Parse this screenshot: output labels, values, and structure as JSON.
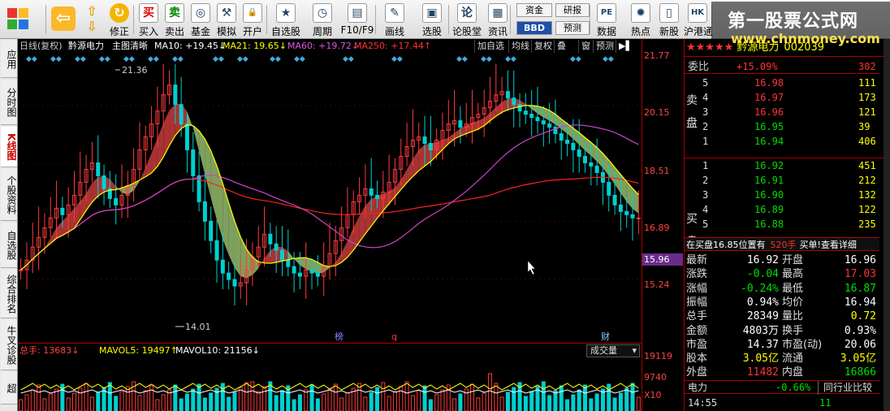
{
  "toolbar": {
    "items": [
      {
        "label": "",
        "icon": "logo-grid-icon"
      },
      {
        "label": "",
        "icon": "back-arrow-icon"
      },
      {
        "label": "",
        "icon": "up-down-arrows-icon"
      },
      {
        "label": "修正",
        "icon": "refresh-icon"
      },
      {
        "label": "买入",
        "icon": "buy-icon",
        "glyph": "买"
      },
      {
        "label": "卖出",
        "icon": "sell-icon",
        "glyph": "卖"
      },
      {
        "label": "基金",
        "icon": "fund-icon",
        "glyph": "◎"
      },
      {
        "label": "模拟",
        "icon": "hammer-icon",
        "glyph": "⚒"
      },
      {
        "label": "开户",
        "icon": "lock-icon",
        "glyph": "🔒"
      },
      {
        "label": "自选股",
        "icon": "star-folder-icon",
        "glyph": "★"
      },
      {
        "label": "周期",
        "icon": "clock-icon",
        "glyph": "◷"
      },
      {
        "label": "F10/F9",
        "icon": "f10-icon",
        "glyph": "▤"
      },
      {
        "label": "画线",
        "icon": "pencil-icon",
        "glyph": "✎"
      },
      {
        "label": "选股",
        "icon": "screen-icon",
        "glyph": "▣"
      },
      {
        "label": "论股堂",
        "icon": "forum-icon",
        "glyph": "论"
      },
      {
        "label": "资讯",
        "icon": "news-icon",
        "glyph": "▦"
      },
      {
        "label": "数据",
        "icon": "pe-icon",
        "glyph": "PE"
      },
      {
        "label": "热点",
        "icon": "flame-icon",
        "glyph": "✹"
      },
      {
        "label": "新股",
        "icon": "ipo-icon",
        "glyph": "▯"
      },
      {
        "label": "沪港通",
        "icon": "hk-icon",
        "glyph": "HK"
      }
    ],
    "small_buttons": [
      "资金",
      "BBD",
      "研报",
      "预测"
    ]
  },
  "watermark": {
    "line1": "第一股票公式网",
    "line2": "www.chnmoney.com"
  },
  "left_tabs": [
    "应用",
    "分时图",
    "K线图",
    "个股资料",
    "自选股",
    "综合排名",
    "牛叉诊股",
    "超"
  ],
  "chart": {
    "period": "日线(复权)",
    "name": "黔源电力",
    "mode": "主图清晰",
    "ma10": "MA10: +19.45↓",
    "ma21": "MA21: 19.65↓",
    "ma60": "MA60: +19.72↓",
    "ma250": "MA250: +17.44↑",
    "tags": [
      "加自选",
      "均线",
      "复权",
      "叠",
      "窗",
      "预测"
    ],
    "high_label": "21.36",
    "low_label": "14.01",
    "markers": [
      "榜",
      "q",
      "财"
    ],
    "price_levels": [
      "21.77",
      "20.15",
      "18.51",
      "16.89",
      "15.96",
      "15.24"
    ],
    "current_price_tag": "15.96",
    "vol_levels": [
      "19119",
      "9740",
      "X10"
    ]
  },
  "chart_data": {
    "type": "candlestick",
    "title": "黔源电力 日线(复权)",
    "ylim": [
      13.6,
      21.77
    ],
    "closes": [
      15.3,
      15.6,
      16.0,
      16.3,
      16.6,
      16.9,
      17.2,
      17.0,
      17.3,
      17.6,
      18.0,
      18.4,
      18.6,
      18.2,
      17.8,
      17.5,
      17.3,
      17.6,
      17.9,
      18.4,
      19.0,
      19.4,
      19.8,
      20.2,
      20.7,
      21.0,
      20.4,
      19.8,
      19.0,
      18.2,
      17.4,
      16.8,
      16.2,
      15.6,
      15.2,
      15.0,
      14.8,
      14.9,
      15.3,
      15.7,
      16.0,
      16.4,
      16.1,
      15.9,
      15.6,
      15.4,
      15.2,
      15.1,
      15.3,
      15.2,
      15.1,
      15.4,
      15.8,
      16.2,
      16.6,
      17.0,
      17.4,
      17.6,
      17.8,
      17.6,
      17.5,
      17.7,
      18.0,
      18.4,
      18.8,
      19.1,
      19.3,
      19.4,
      19.2,
      19.0,
      19.3,
      19.6,
      19.8,
      19.9,
      19.7,
      19.8,
      20.0,
      20.1,
      20.3,
      20.5,
      20.7,
      20.8,
      20.6,
      20.4,
      20.2,
      20.1,
      20.0,
      19.9,
      19.8,
      19.7,
      19.5,
      19.3,
      19.2,
      19.0,
      18.8,
      18.6,
      18.5,
      18.3,
      18.0,
      17.6,
      17.3,
      17.1,
      17.0,
      16.9,
      16.9
    ]
  },
  "volume": {
    "label": "总手: 13683↓",
    "mavol5": "MAVOL5: 19497↑",
    "mavol10": "MAVOL10: 21156↓",
    "selector": "成交量"
  },
  "quote": {
    "name": "黔源电力",
    "code": "002039",
    "weibi_label": "委比",
    "weibi_pct": "+15.09%",
    "weibi_val": "302",
    "sell_side_label": [
      "卖",
      "盘"
    ],
    "buy_side_label": [
      "买",
      "盘"
    ],
    "asks": [
      {
        "lv": "5",
        "price": "16.98",
        "vol": "111"
      },
      {
        "lv": "4",
        "price": "16.97",
        "vol": "173"
      },
      {
        "lv": "3",
        "price": "16.96",
        "vol": "121"
      },
      {
        "lv": "2",
        "price": "16.95",
        "vol": "39"
      },
      {
        "lv": "1",
        "price": "16.94",
        "vol": "406"
      }
    ],
    "bids": [
      {
        "lv": "1",
        "price": "16.92",
        "vol": "451"
      },
      {
        "lv": "2",
        "price": "16.91",
        "vol": "212"
      },
      {
        "lv": "3",
        "price": "16.90",
        "vol": "132"
      },
      {
        "lv": "4",
        "price": "16.89",
        "vol": "122"
      },
      {
        "lv": "5",
        "price": "16.88",
        "vol": "235"
      }
    ],
    "notice": "在买盘16.85位置有",
    "notice_vol": "520手",
    "notice_tail": "买单!查看详细",
    "stats": [
      {
        "l1": "最新",
        "v1": "16.92",
        "l2": "开盘",
        "v2": "16.96"
      },
      {
        "l1": "涨跌",
        "v1": "-0.04",
        "l2": "最高",
        "v2": "17.03"
      },
      {
        "l1": "涨幅",
        "v1": "-0.24%",
        "l2": "最低",
        "v2": "16.87"
      },
      {
        "l1": "振幅",
        "v1": "0.94%",
        "l2": "均价",
        "v2": "16.94"
      },
      {
        "l1": "总手",
        "v1": "28349",
        "l2": "量比",
        "v2": "0.72"
      },
      {
        "l1": "金额",
        "v1": "4803万",
        "l2": "换手",
        "v2": "0.93%"
      },
      {
        "l1": "市盈",
        "v1": "14.37",
        "l2": "市盈(动)",
        "v2": "20.06"
      },
      {
        "l1": "股本",
        "v1": "3.05亿",
        "l2": "流通",
        "v2": "3.05亿"
      },
      {
        "l1": "外盘",
        "v1": "11482",
        "l2": "内盘",
        "v2": "16866"
      }
    ],
    "sector_label": "电力",
    "sector_pct": "-0.66%",
    "sector_btn": "同行业比较",
    "tick_time": "14:55",
    "tick_vol": "11"
  },
  "colors": {
    "up": "#ff3b3b",
    "down": "#00d0d0",
    "ma10": "#ffffff",
    "ma21": "#ffff00",
    "ma60": "#cc44cc",
    "ma250": "#ff2020"
  }
}
